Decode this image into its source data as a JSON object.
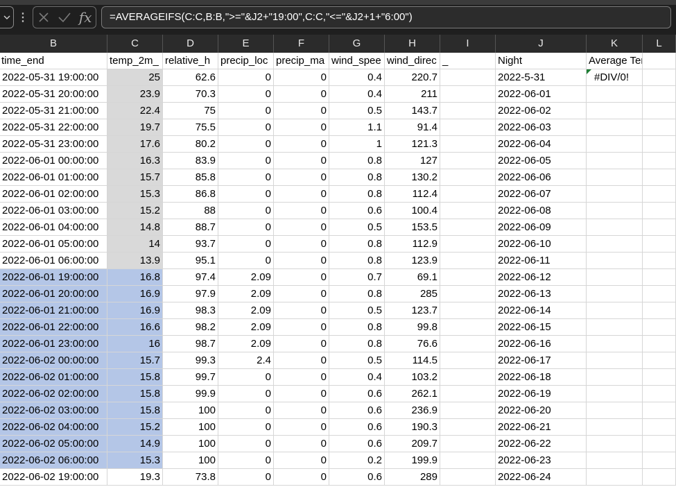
{
  "formula_bar": {
    "formula": "=AVERAGEIFS(C:C,B:B,\">=\"&J2+\"19:00\",C:C,\"<=\"&J2+1+\"6:00\")",
    "fx_label": "fx"
  },
  "columns": [
    "B",
    "C",
    "D",
    "E",
    "F",
    "G",
    "H",
    "I",
    "J",
    "K",
    "L"
  ],
  "headers": {
    "B": "time_end",
    "C": "temp_2m_",
    "D": "relative_h",
    "E": "precip_loc",
    "F": "precip_ma",
    "G": "wind_spee",
    "H": "wind_direc",
    "I": "_",
    "J": "Night",
    "K": "Average Temp",
    "L": ""
  },
  "rows": [
    {
      "B": "2022-05-31 19:00:00",
      "C": "25",
      "D": "62.6",
      "E": "0",
      "F": "0",
      "G": "0.4",
      "H": "220.7",
      "J": "2022-5-31",
      "K": "#DIV/0!",
      "shade": "gray"
    },
    {
      "B": "2022-05-31 20:00:00",
      "C": "23.9",
      "D": "70.3",
      "E": "0",
      "F": "0",
      "G": "0.4",
      "H": "211",
      "J": "2022-06-01",
      "K": "",
      "shade": "gray"
    },
    {
      "B": "2022-05-31 21:00:00",
      "C": "22.4",
      "D": "75",
      "E": "0",
      "F": "0",
      "G": "0.5",
      "H": "143.7",
      "J": "2022-06-02",
      "K": "",
      "shade": "gray"
    },
    {
      "B": "2022-05-31 22:00:00",
      "C": "19.7",
      "D": "75.5",
      "E": "0",
      "F": "0",
      "G": "1.1",
      "H": "91.4",
      "J": "2022-06-03",
      "K": "",
      "shade": "gray"
    },
    {
      "B": "2022-05-31 23:00:00",
      "C": "17.6",
      "D": "80.2",
      "E": "0",
      "F": "0",
      "G": "1",
      "H": "121.3",
      "J": "2022-06-04",
      "K": "",
      "shade": "gray"
    },
    {
      "B": "2022-06-01 00:00:00",
      "C": "16.3",
      "D": "83.9",
      "E": "0",
      "F": "0",
      "G": "0.8",
      "H": "127",
      "J": "2022-06-05",
      "K": "",
      "shade": "gray"
    },
    {
      "B": "2022-06-01 01:00:00",
      "C": "15.7",
      "D": "85.8",
      "E": "0",
      "F": "0",
      "G": "0.8",
      "H": "130.2",
      "J": "2022-06-06",
      "K": "",
      "shade": "gray"
    },
    {
      "B": "2022-06-01 02:00:00",
      "C": "15.3",
      "D": "86.8",
      "E": "0",
      "F": "0",
      "G": "0.8",
      "H": "112.4",
      "J": "2022-06-07",
      "K": "",
      "shade": "gray"
    },
    {
      "B": "2022-06-01 03:00:00",
      "C": "15.2",
      "D": "88",
      "E": "0",
      "F": "0",
      "G": "0.6",
      "H": "100.4",
      "J": "2022-06-08",
      "K": "",
      "shade": "gray"
    },
    {
      "B": "2022-06-01 04:00:00",
      "C": "14.8",
      "D": "88.7",
      "E": "0",
      "F": "0",
      "G": "0.5",
      "H": "153.5",
      "J": "2022-06-09",
      "K": "",
      "shade": "gray"
    },
    {
      "B": "2022-06-01 05:00:00",
      "C": "14",
      "D": "93.7",
      "E": "0",
      "F": "0",
      "G": "0.8",
      "H": "112.9",
      "J": "2022-06-10",
      "K": "",
      "shade": "gray"
    },
    {
      "B": "2022-06-01 06:00:00",
      "C": "13.9",
      "D": "95.1",
      "E": "0",
      "F": "0",
      "G": "0.8",
      "H": "123.9",
      "J": "2022-06-11",
      "K": "",
      "shade": "gray"
    },
    {
      "B": "2022-06-01 19:00:00",
      "C": "16.8",
      "D": "97.4",
      "E": "2.09",
      "F": "0",
      "G": "0.7",
      "H": "69.1",
      "J": "2022-06-12",
      "K": "",
      "shade": "blue"
    },
    {
      "B": "2022-06-01 20:00:00",
      "C": "16.9",
      "D": "97.9",
      "E": "2.09",
      "F": "0",
      "G": "0.8",
      "H": "285",
      "J": "2022-06-13",
      "K": "",
      "shade": "blue"
    },
    {
      "B": "2022-06-01 21:00:00",
      "C": "16.9",
      "D": "98.3",
      "E": "2.09",
      "F": "0",
      "G": "0.5",
      "H": "123.7",
      "J": "2022-06-14",
      "K": "",
      "shade": "blue"
    },
    {
      "B": "2022-06-01 22:00:00",
      "C": "16.6",
      "D": "98.2",
      "E": "2.09",
      "F": "0",
      "G": "0.8",
      "H": "99.8",
      "J": "2022-06-15",
      "K": "",
      "shade": "blue"
    },
    {
      "B": "2022-06-01 23:00:00",
      "C": "16",
      "D": "98.7",
      "E": "2.09",
      "F": "0",
      "G": "0.8",
      "H": "76.6",
      "J": "2022-06-16",
      "K": "",
      "shade": "blue"
    },
    {
      "B": "2022-06-02 00:00:00",
      "C": "15.7",
      "D": "99.3",
      "E": "2.4",
      "F": "0",
      "G": "0.5",
      "H": "114.5",
      "J": "2022-06-17",
      "K": "",
      "shade": "blue"
    },
    {
      "B": "2022-06-02 01:00:00",
      "C": "15.8",
      "D": "99.7",
      "E": "0",
      "F": "0",
      "G": "0.4",
      "H": "103.2",
      "J": "2022-06-18",
      "K": "",
      "shade": "blue"
    },
    {
      "B": "2022-06-02 02:00:00",
      "C": "15.8",
      "D": "99.9",
      "E": "0",
      "F": "0",
      "G": "0.6",
      "H": "262.1",
      "J": "2022-06-19",
      "K": "",
      "shade": "blue"
    },
    {
      "B": "2022-06-02 03:00:00",
      "C": "15.8",
      "D": "100",
      "E": "0",
      "F": "0",
      "G": "0.6",
      "H": "236.9",
      "J": "2022-06-20",
      "K": "",
      "shade": "blue"
    },
    {
      "B": "2022-06-02 04:00:00",
      "C": "15.2",
      "D": "100",
      "E": "0",
      "F": "0",
      "G": "0.6",
      "H": "190.3",
      "J": "2022-06-21",
      "K": "",
      "shade": "blue"
    },
    {
      "B": "2022-06-02 05:00:00",
      "C": "14.9",
      "D": "100",
      "E": "0",
      "F": "0",
      "G": "0.6",
      "H": "209.7",
      "J": "2022-06-22",
      "K": "",
      "shade": "blue"
    },
    {
      "B": "2022-06-02 06:00:00",
      "C": "15.3",
      "D": "100",
      "E": "0",
      "F": "0",
      "G": "0.2",
      "H": "199.9",
      "J": "2022-06-23",
      "K": "",
      "shade": "blue"
    },
    {
      "B": "2022-06-02 19:00:00",
      "C": "19.3",
      "D": "73.8",
      "E": "0",
      "F": "0",
      "G": "0.6",
      "H": "289",
      "J": "2022-06-24",
      "K": "",
      "shade": "none"
    }
  ]
}
